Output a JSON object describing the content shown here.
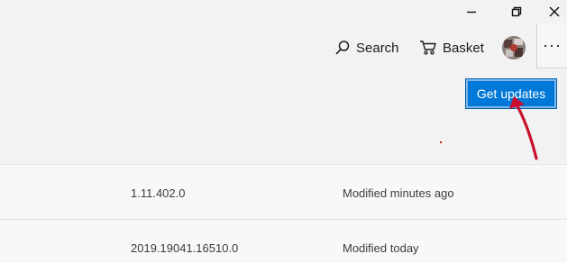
{
  "window_controls": {
    "minimize_icon": "minimize-icon",
    "restore_icon": "restore-icon",
    "close_icon": "close-icon"
  },
  "toolbar": {
    "search_label": "Search",
    "search_icon": "search-icon",
    "basket_label": "Basket",
    "basket_icon": "basket-icon",
    "avatar": "user-avatar",
    "more_label": "···"
  },
  "actions": {
    "get_updates_label": "Get updates"
  },
  "annotation": {
    "arrow_color": "#c8102e"
  },
  "app_list": {
    "rows": [
      {
        "version": "1.11.402.0",
        "modified": "Modified minutes ago"
      },
      {
        "version": "2019.19041.16510.0",
        "modified": "Modified today"
      }
    ]
  },
  "colors": {
    "accent": "#0078d7",
    "background": "#f2f2f2",
    "row_background": "#f8f8f8"
  }
}
